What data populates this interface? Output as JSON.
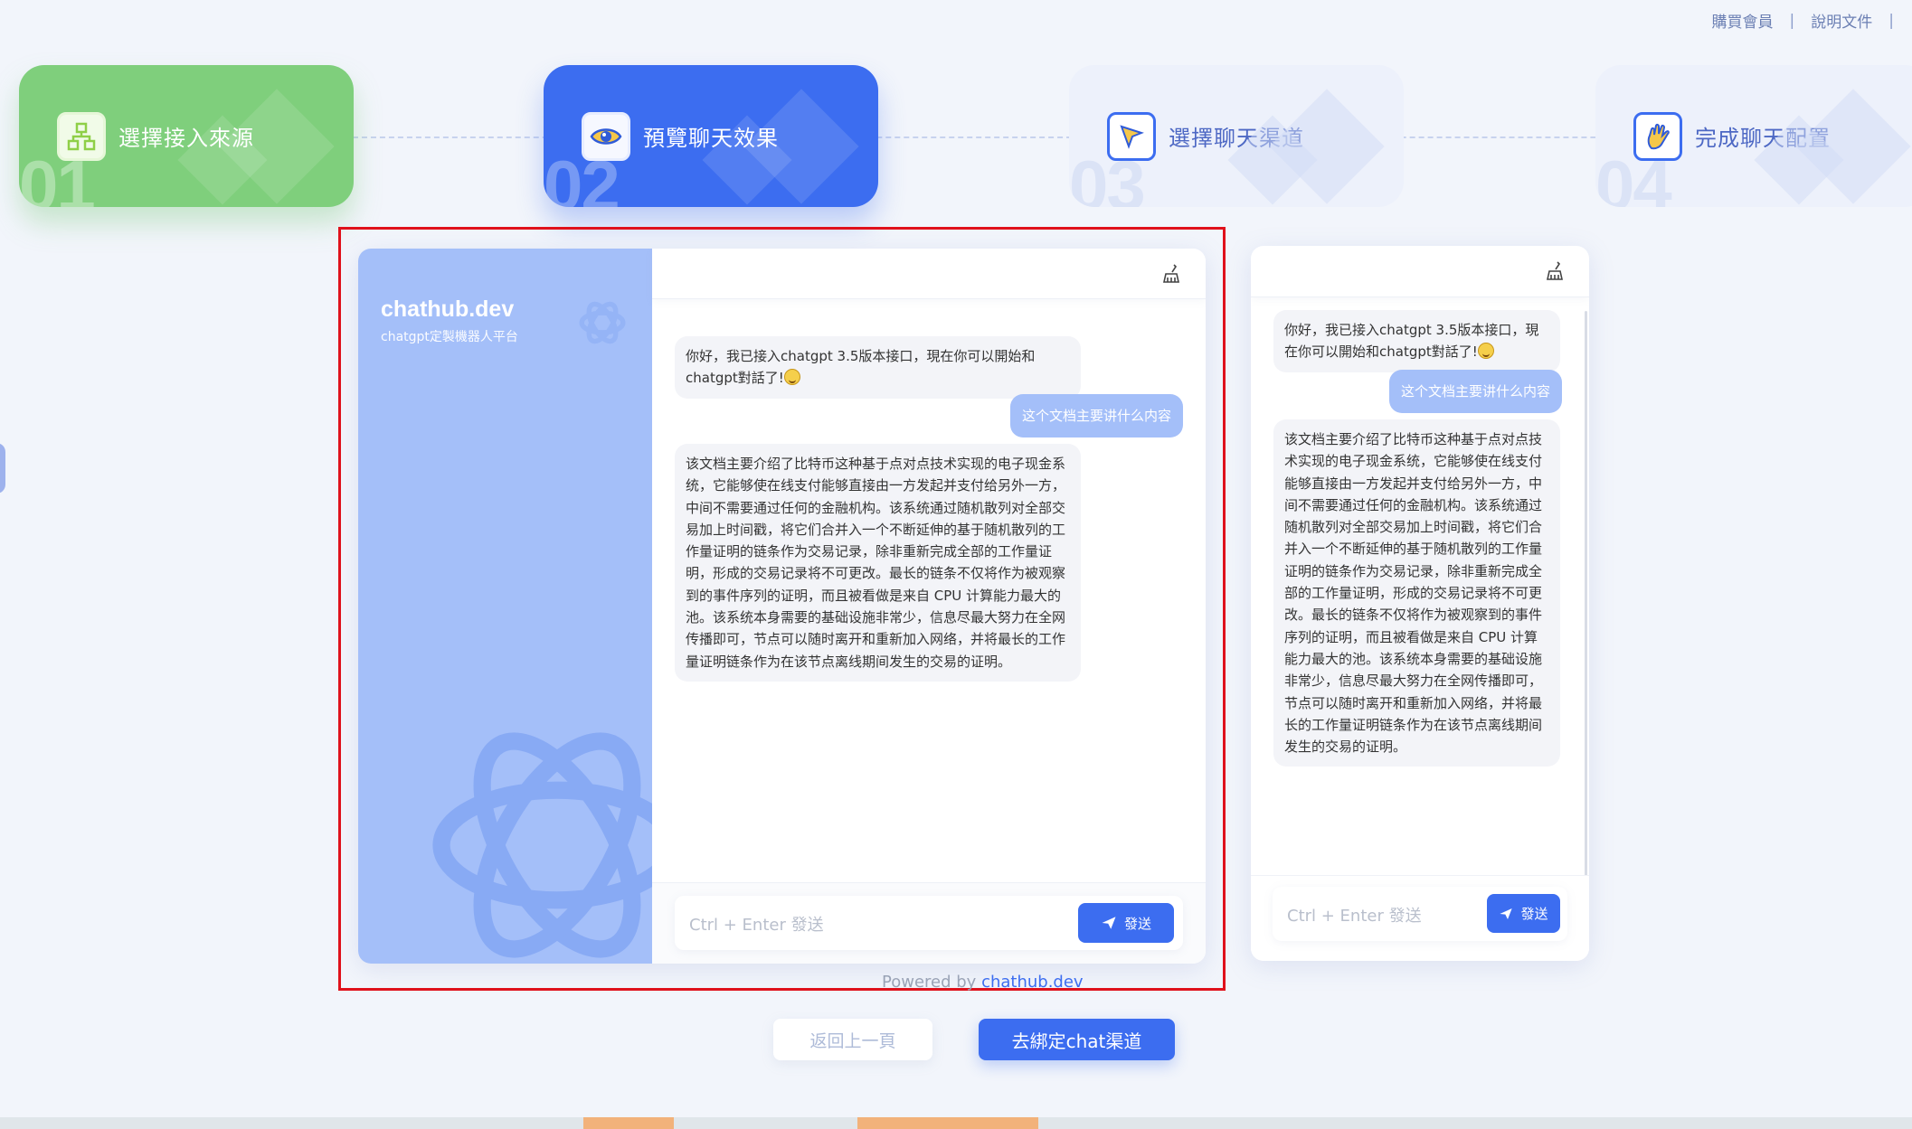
{
  "top_links": {
    "buy_member": "購買會員",
    "docs": "說明文件",
    "separator": "|"
  },
  "steps": [
    {
      "label": "選擇接入來源",
      "number": "01",
      "icon": "sitemap-icon",
      "state": "done"
    },
    {
      "label": "預覽聊天效果",
      "number": "02",
      "icon": "eye-icon",
      "state": "active"
    },
    {
      "label": "選擇聊天渠道",
      "number": "03",
      "icon": "cursor-icon",
      "state": "pending"
    },
    {
      "label": "完成聊天配置",
      "number": "04",
      "icon": "hand-icon",
      "state": "pending"
    }
  ],
  "preview": {
    "brand": "chathub.dev",
    "brand_sub": "chatgpt定製機器人平台",
    "greeting": "你好，我已接入chatgpt 3.5版本接口，現在你可以開始和chatgpt對話了!",
    "user_question": "这个文档主要讲什么内容",
    "answer": "该文档主要介绍了比特币这种基于点对点技术实现的电子现金系统，它能够使在线支付能够直接由一方发起并支付给另外一方，中间不需要通过任何的金融机构。该系统通过随机散列对全部交易加上时间戳，将它们合并入一个不断延伸的基于随机散列的工作量证明的链条作为交易记录，除非重新完成全部的工作量证明，形成的交易记录将不可更改。最长的链条不仅将作为被观察到的事件序列的证明，而且被看做是来自 CPU 计算能力最大的池。该系统本身需要的基础设施非常少，信息尽最大努力在全网传播即可，节点可以随时离开和重新加入网络，并将最长的工作量证明链条作为在该节点离线期间发生的交易的证明。",
    "input_placeholder": "Ctrl + Enter 發送",
    "send_label": "發送",
    "powered_prefix": "Powered by ",
    "powered_link": "chathub.dev"
  },
  "actions": {
    "back": "返回上一頁",
    "next": "去綁定chat渠道"
  },
  "colors": {
    "primary": "#3c6df0",
    "success": "#7fcf7c",
    "sidebar": "#a4bff9",
    "highlight_border": "#e0111b"
  }
}
